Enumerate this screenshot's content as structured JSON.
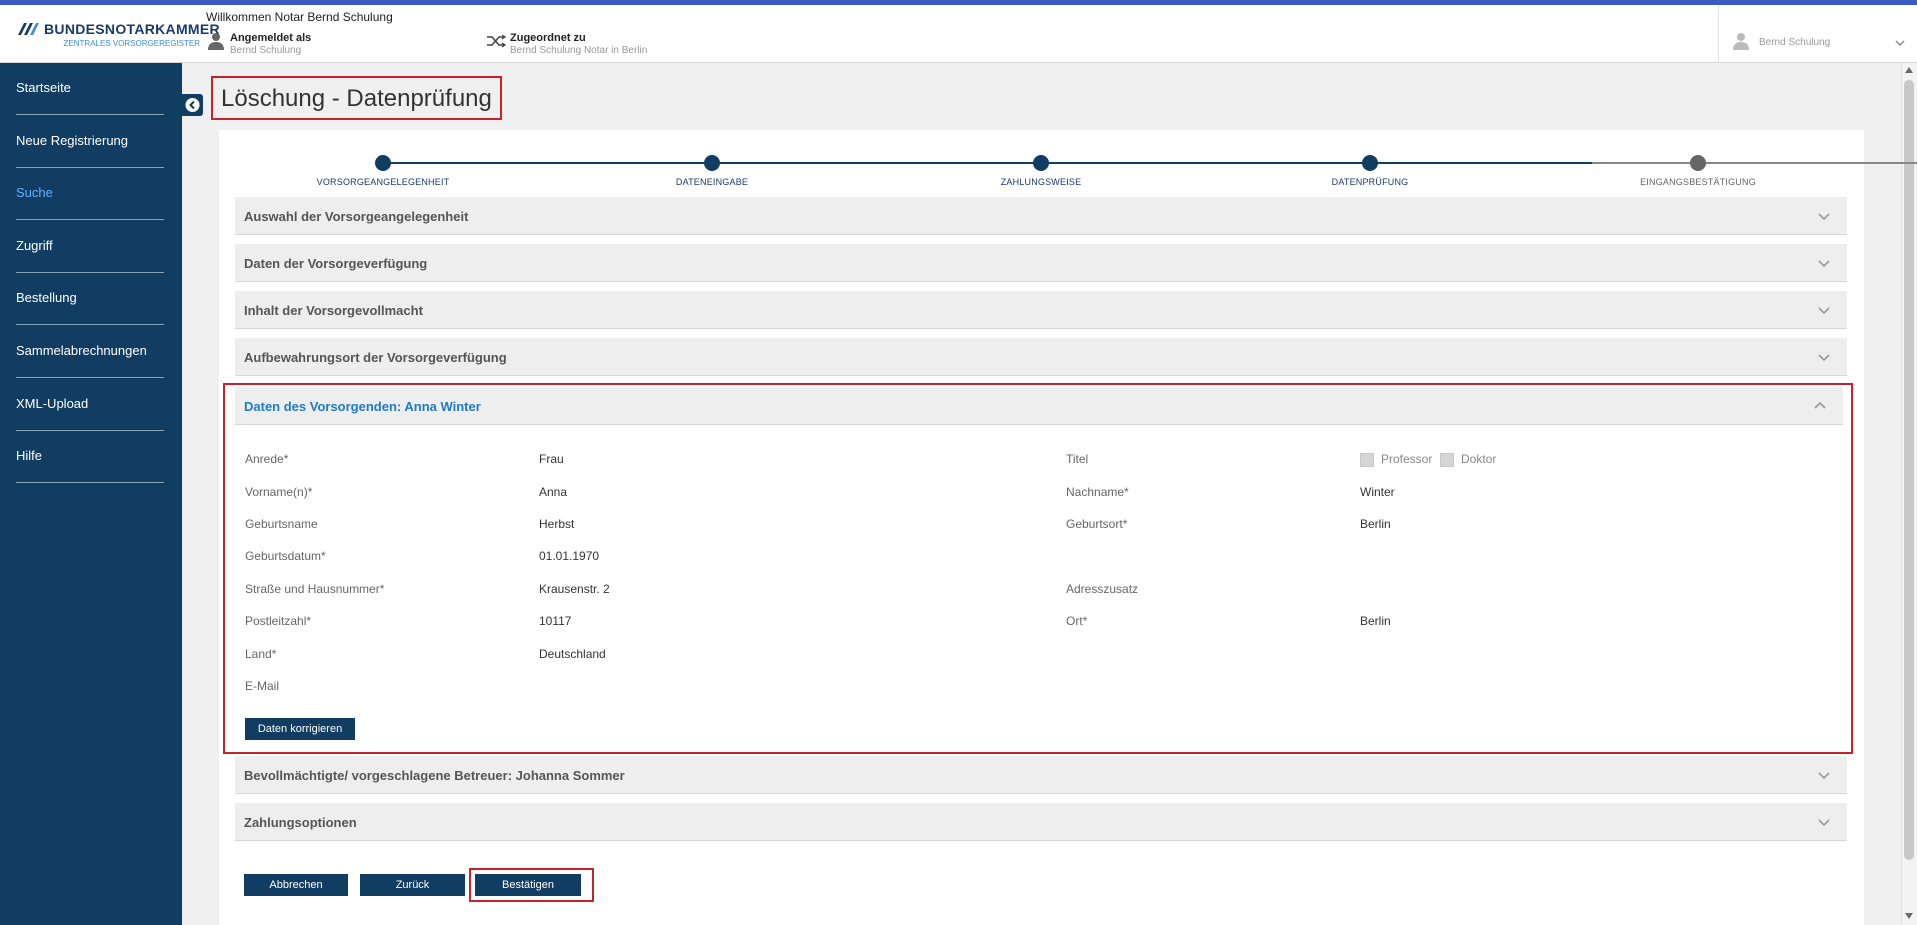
{
  "brand": {
    "title": "BUNDESNOTARKAMMER",
    "subtitle": "ZENTRALES VORSORGEREGISTER",
    "stripe_color": "#3a5bbf",
    "primary_color": "#113d63",
    "highlight_color": "#c8232c"
  },
  "header": {
    "welcome": "Willkommen Notar Bernd Schulung",
    "logged_in_label": "Angemeldet als",
    "logged_in_value": "Bernd Schulung",
    "assigned_label": "Zugeordnet zu",
    "assigned_value": "Bernd Schulung Notar in Berlin",
    "user_menu_name": "Bernd Schulung",
    "user_icon": "person-icon",
    "assign_icon": "shuffle-icon"
  },
  "sidebar": {
    "items": [
      {
        "label": "Startseite"
      },
      {
        "label": "Neue Registrierung"
      },
      {
        "label": "Suche"
      },
      {
        "label": "Zugriff"
      },
      {
        "label": "Bestellung"
      },
      {
        "label": "Sammelabrechnungen"
      },
      {
        "label": "XML-Upload"
      },
      {
        "label": "Hilfe"
      }
    ],
    "active": "Suche"
  },
  "page": {
    "title": "Löschung - Datenprüfung"
  },
  "stepper": {
    "steps": [
      {
        "label": "VORSORGEANGELEGENHEIT",
        "state": "done"
      },
      {
        "label": "DATENEINGABE",
        "state": "done"
      },
      {
        "label": "ZAHLUNGSWEISE",
        "state": "done"
      },
      {
        "label": "DATENPRÜFUNG",
        "state": "current"
      },
      {
        "label": "EINGANGSBESTÄTIGUNG",
        "state": "todo"
      }
    ]
  },
  "panels": {
    "p1": "Auswahl der Vorsorgeangelegenheit",
    "p2": "Daten der Vorsorgeverfügung",
    "p3": "Inhalt der Vorsorgevollmacht",
    "p4": "Aufbewahrungsort der Vorsorgeverfügung",
    "p5": "Daten des Vorsorgenden: Anna Winter",
    "p6": "Bevollmächtigte/ vorgeschlagene Betreuer: Johanna Sommer",
    "p7": "Zahlungsoptionen"
  },
  "person": {
    "anrede_label": "Anrede*",
    "anrede_value": "Frau",
    "titel_label": "Titel",
    "titel_options": [
      "Professor",
      "Doktor"
    ],
    "vorname_label": "Vorname(n)*",
    "vorname_value": "Anna",
    "nachname_label": "Nachname*",
    "nachname_value": "Winter",
    "geburtsname_label": "Geburtsname",
    "geburtsname_value": "Herbst",
    "geburtsort_label": "Geburtsort*",
    "geburtsort_value": "Berlin",
    "geburtsdatum_label": "Geburtsdatum*",
    "geburtsdatum_value": "01.01.1970",
    "strasse_label": "Straße und Hausnummer*",
    "strasse_value": "Krausenstr. 2",
    "adresszusatz_label": "Adresszusatz",
    "plz_label": "Postleitzahl*",
    "plz_value": "10117",
    "ort_label": "Ort*",
    "ort_value": "Berlin",
    "land_label": "Land*",
    "land_value": "Deutschland",
    "email_label": "E-Mail",
    "correct_button": "Daten korrigieren"
  },
  "actions": {
    "cancel": "Abbrechen",
    "back": "Zurück",
    "confirm": "Bestätigen"
  }
}
